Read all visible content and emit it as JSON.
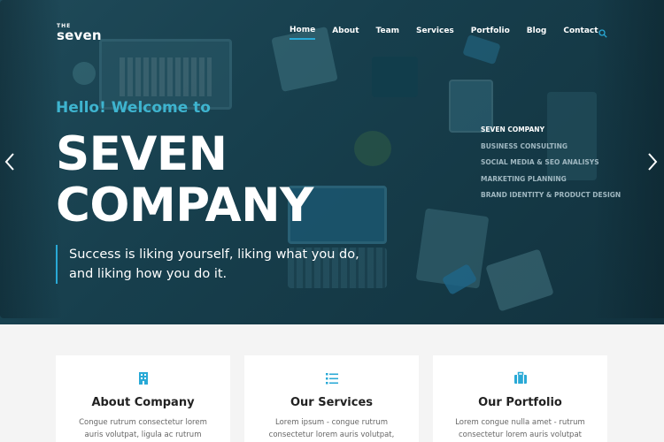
{
  "brand": {
    "small": "THE",
    "name": "seven"
  },
  "nav": {
    "items": [
      {
        "label": "Home"
      },
      {
        "label": "About"
      },
      {
        "label": "Team"
      },
      {
        "label": "Services"
      },
      {
        "label": "Portfolio"
      },
      {
        "label": "Blog"
      },
      {
        "label": "Contact"
      }
    ],
    "active": "Home",
    "search_icon": "search-icon"
  },
  "hero": {
    "greeting": "Hello! Welcome to",
    "headline_line1": "SEVEN",
    "headline_line2": "COMPANY",
    "quote_line1": "Success is liking yourself, liking what you do,",
    "quote_line2": "and liking how you do it."
  },
  "slides": [
    {
      "label": "SEVEN COMPANY"
    },
    {
      "label": "BUSINESS CONSULTING"
    },
    {
      "label": "SOCIAL MEDIA & SEO ANALISYS"
    },
    {
      "label": "MARKETING PLANNING"
    },
    {
      "label": "BRAND IDENTITY & PRODUCT DESIGN"
    }
  ],
  "cards": [
    {
      "icon": "building-icon",
      "title": "About Company",
      "text": "Congue rutrum consectetur lorem auris volutpat, ligula ac rutrum lorem"
    },
    {
      "icon": "list-icon",
      "title": "Our Services",
      "text": "Lorem ipsum - congue rutrum consectetur lorem auris volutpat,"
    },
    {
      "icon": "briefcase-icon",
      "title": "Our Portfolio",
      "text": "Lorem congue nulla amet - rutrum consectetur lorem auris volutpat"
    }
  ],
  "colors": {
    "accent": "#29a9d6",
    "greeting": "#3eb4cf",
    "hero_bg": "#173f4d",
    "page_bg": "#f4f4f4"
  }
}
